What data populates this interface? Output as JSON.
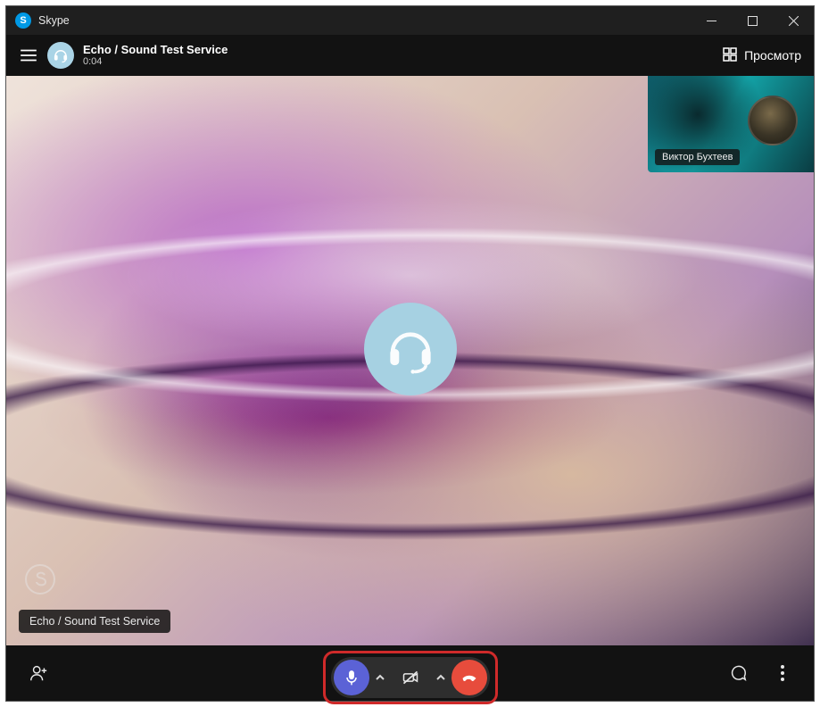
{
  "window": {
    "app_name": "Skype",
    "app_icon_letter": "S"
  },
  "call": {
    "contact_name": "Echo / Sound Test Service",
    "duration": "0:04",
    "caption_label": "Echo / Sound Test Service",
    "view_toggle_label": "Просмотр"
  },
  "pip": {
    "self_name": "Виктор Бухтеев"
  },
  "controls": {
    "mic_state": "on",
    "camera_state": "off",
    "end_call_label": "End call"
  }
}
